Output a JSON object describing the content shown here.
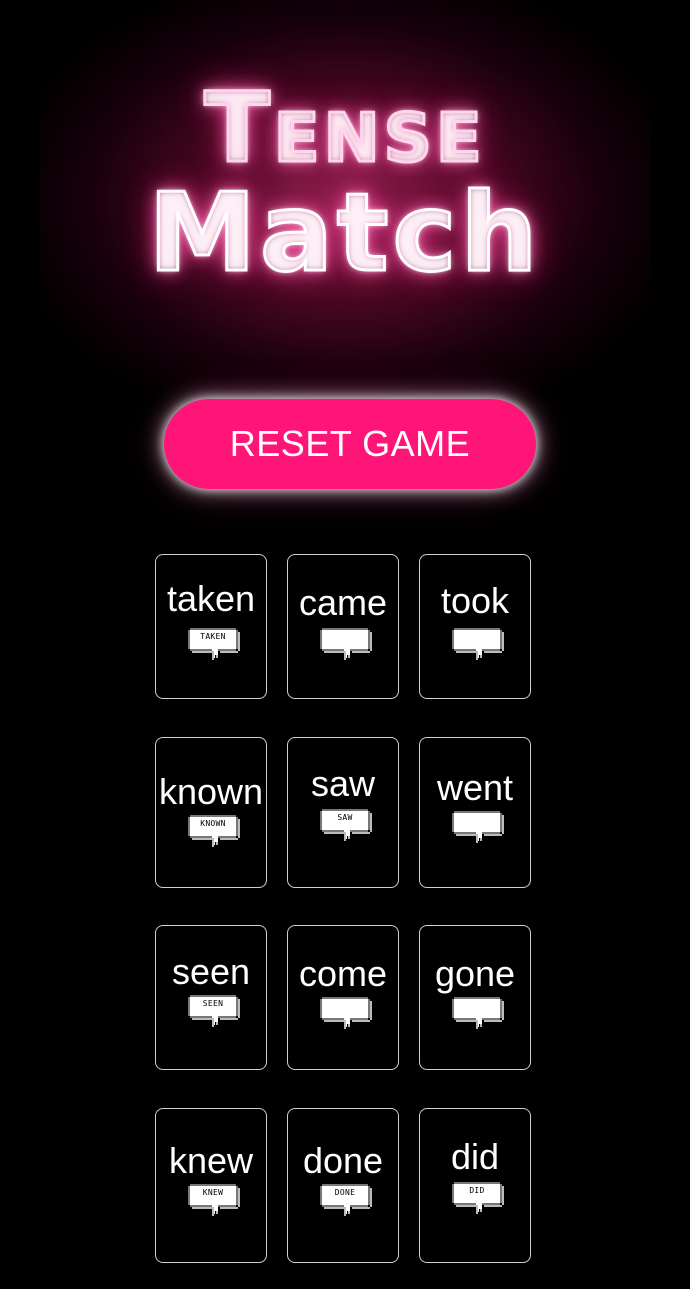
{
  "title": {
    "line1": "Tense",
    "line2": "Match"
  },
  "reset_button": {
    "label": "RESET GAME"
  },
  "cards": [
    {
      "word": "taken",
      "bubble": "TAKEN"
    },
    {
      "word": "came",
      "bubble": ""
    },
    {
      "word": "took",
      "bubble": ""
    },
    {
      "word": "known",
      "bubble": "KNOWN"
    },
    {
      "word": "saw",
      "bubble": "SAW"
    },
    {
      "word": "went",
      "bubble": ""
    },
    {
      "word": "seen",
      "bubble": "SEEN"
    },
    {
      "word": "come",
      "bubble": ""
    },
    {
      "word": "gone",
      "bubble": ""
    },
    {
      "word": "knew",
      "bubble": "KNEW"
    },
    {
      "word": "done",
      "bubble": "DONE"
    },
    {
      "word": "did",
      "bubble": "DID"
    }
  ],
  "colors": {
    "background": "#000000",
    "accent": "#ff1577",
    "title_glow": "#ff3c8c",
    "card_border": "#cfcfcf"
  },
  "icons": {
    "bubble": "speech-bubble-icon"
  }
}
